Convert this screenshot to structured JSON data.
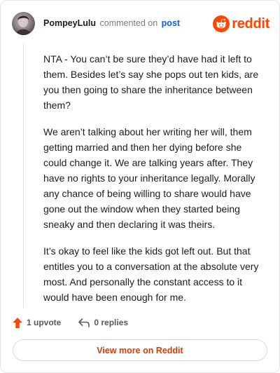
{
  "header": {
    "username": "PompeyLulu",
    "action_text": "commented on",
    "post_link_label": "post",
    "brand_word": "reddit"
  },
  "comment": {
    "paragraphs": [
      "NTA - You can’t be sure they’d have had it left to them. Besides let’s say she pops out ten kids, are you then going to share the inheritance between them?",
      "We aren’t talking about her writing her will, them getting married and then her dying before she could change it. We are talking years after. They have no rights to your inheritance legally. Morally any chance of being willing to share would have gone out the window when they started being sneaky and then declaring it was theirs.",
      "It’s okay to feel like the kids got left out. But that entitles you to a conversation at the absolute very most. And personally the constant access to it would have been enough for me."
    ]
  },
  "actions": {
    "upvote_label": "1 upvote",
    "replies_label": "0 replies"
  },
  "footer": {
    "view_more_label": "View more on Reddit"
  },
  "colors": {
    "brand_orange": "#ff4500",
    "upvote_orange": "#ff4500",
    "link_blue": "#0b5ed7",
    "view_more_text": "#d93a00"
  },
  "icons": {
    "avatar": "user-avatar",
    "brand": "reddit-snoo-icon",
    "upvote": "upvote-arrow-icon",
    "reply": "reply-arrow-icon"
  }
}
